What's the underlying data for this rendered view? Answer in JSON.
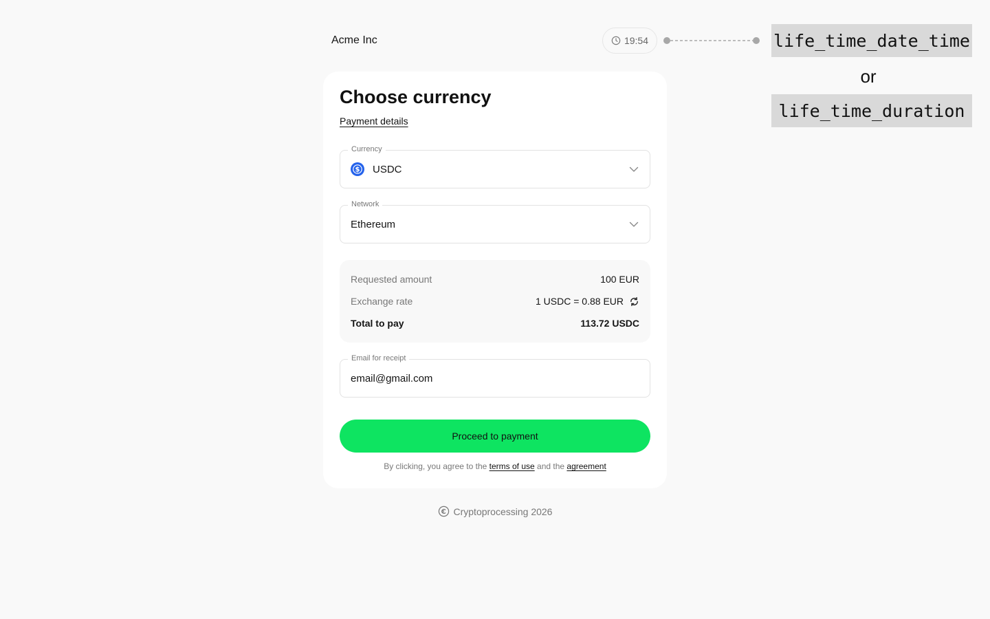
{
  "merchant": {
    "name": "Acme Inc"
  },
  "timer": {
    "value": "19:54",
    "icon": "clock-icon"
  },
  "annotation": {
    "tag_a": "life_time_date_time",
    "or": "or",
    "tag_b": "life_time_duration"
  },
  "card": {
    "title": "Choose currency",
    "details_link": "Payment details",
    "currency": {
      "label": "Currency",
      "value": "USDC",
      "icon": "usdc-coin-icon",
      "icon_color": "#2563eb"
    },
    "network": {
      "label": "Network",
      "value": "Ethereum"
    },
    "summary": {
      "requested_label": "Requested amount",
      "requested_value": "100 EUR",
      "rate_label": "Exchange rate",
      "rate_value": "1 USDC = 0.88 EUR",
      "total_label": "Total to pay",
      "total_value": "113.72 USDC"
    },
    "email": {
      "label": "Email for receipt",
      "value": "email@gmail.com"
    },
    "cta_label": "Proceed to payment",
    "legal": {
      "prefix": "By clicking, you agree to the",
      "terms": "terms of use",
      "middle": "and the",
      "agreement": "agreement"
    }
  },
  "footer": {
    "text": "Cryptoprocessing 2026",
    "icon": "copyright-icon"
  },
  "colors": {
    "accent": "#0ee461",
    "background": "#f9f9f9",
    "card": "#ffffff"
  }
}
